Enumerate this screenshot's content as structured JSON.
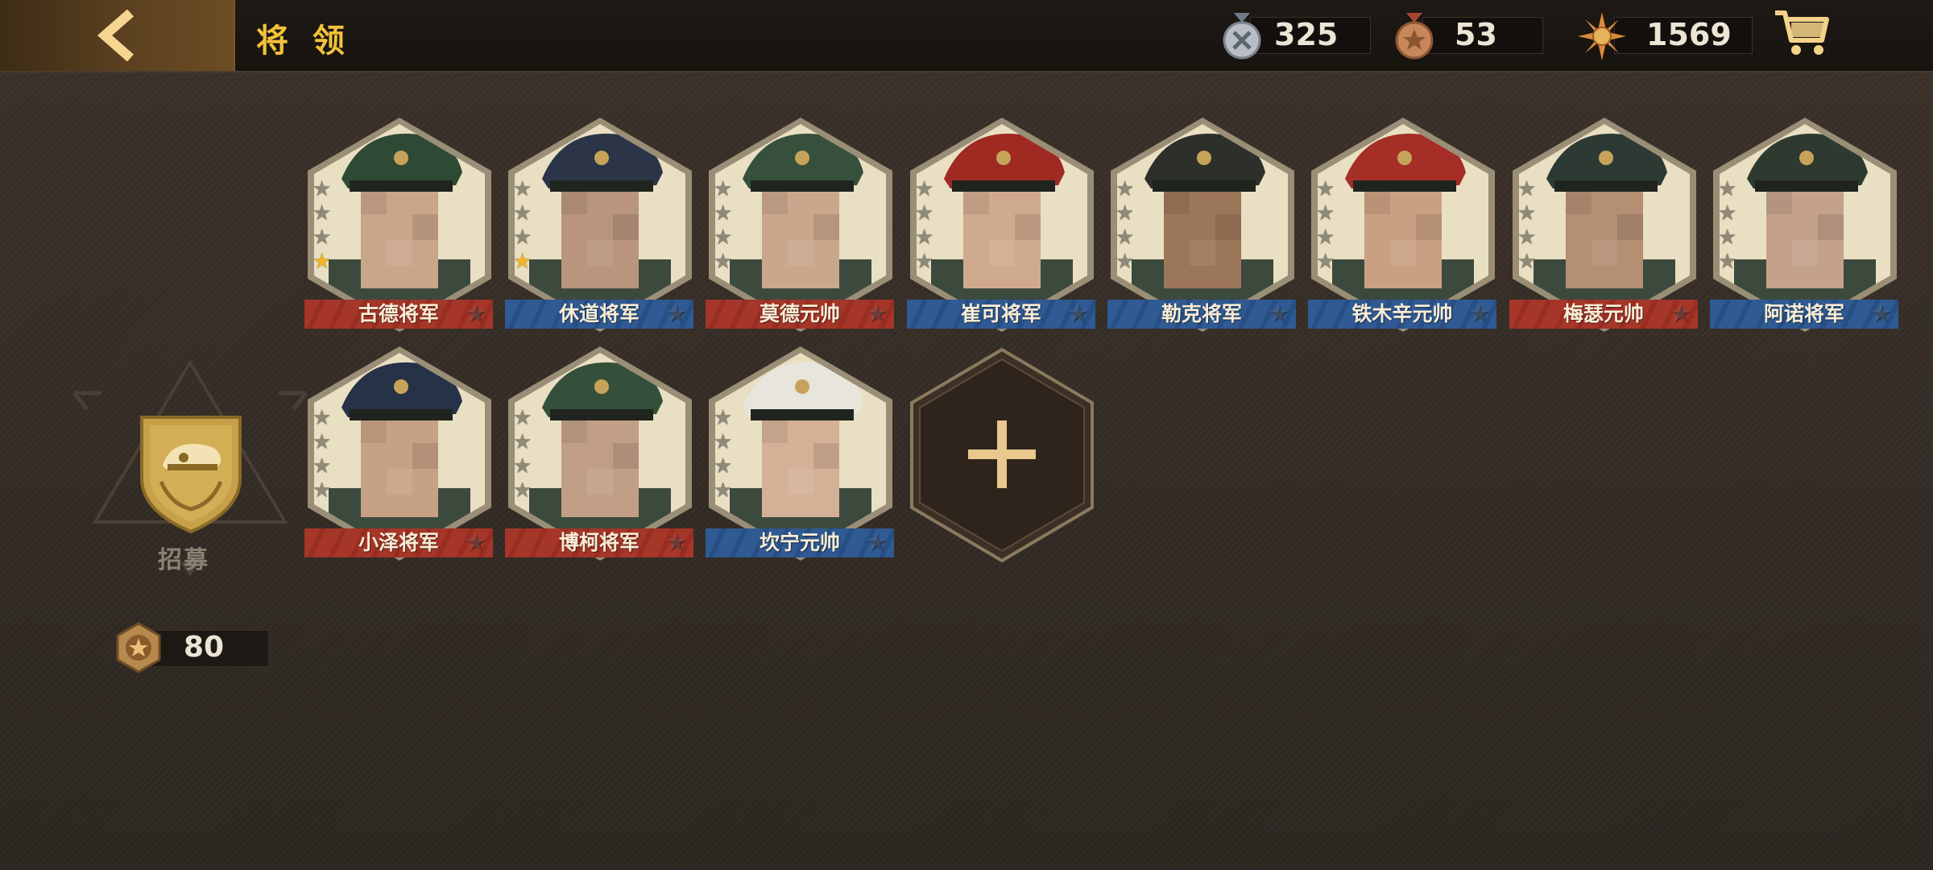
{
  "header": {
    "title": "将 领",
    "back_icon": "chevron-left-icon",
    "resources": [
      {
        "icon": "silver-medal-icon",
        "value": "325"
      },
      {
        "icon": "bronze-medal-icon",
        "value": "53"
      },
      {
        "icon": "sun-emblem-icon",
        "value": "1569"
      }
    ],
    "cart_icon": "shopping-cart-icon"
  },
  "generals": [
    {
      "name": "古德将军",
      "faction": "red",
      "gold_stars": 1
    },
    {
      "name": "休道将军",
      "faction": "blue",
      "gold_stars": 1
    },
    {
      "name": "莫德元帅",
      "faction": "red",
      "gold_stars": 0
    },
    {
      "name": "崔可将军",
      "faction": "blue",
      "gold_stars": 0
    },
    {
      "name": "勒克将军",
      "faction": "blue",
      "gold_stars": 0
    },
    {
      "name": "铁木辛元帅",
      "faction": "blue",
      "gold_stars": 0
    },
    {
      "name": "梅瑟元帅",
      "faction": "red",
      "gold_stars": 0
    },
    {
      "name": "阿诺将军",
      "faction": "blue",
      "gold_stars": 0
    },
    {
      "name": "小泽将军",
      "faction": "red",
      "gold_stars": 0
    },
    {
      "name": "博柯将军",
      "faction": "red",
      "gold_stars": 0
    },
    {
      "name": "坎宁元帅",
      "faction": "blue",
      "gold_stars": 0
    }
  ],
  "add_slot_icon": "plus-icon",
  "recruit": {
    "label": "招募",
    "icon": "officer-cap-badge-icon",
    "cost_icon": "star-medal-icon",
    "cost": "80"
  },
  "colors": {
    "title_gold": "#f2c23a",
    "red_faction": "#a53628",
    "blue_faction": "#2f5a93",
    "gold_star": "#f0b62a"
  }
}
